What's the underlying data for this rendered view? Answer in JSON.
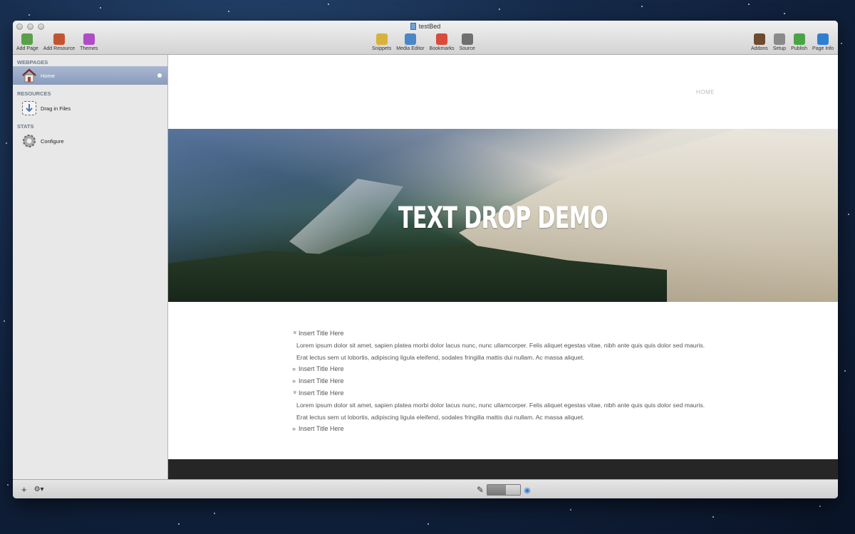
{
  "window": {
    "title": "testBed"
  },
  "toolbar": {
    "left": [
      {
        "label": "Add Page",
        "icon": "add-page-icon",
        "color": "#5aa04a"
      },
      {
        "label": "Add Resource",
        "icon": "add-resource-icon",
        "color": "#c2552f"
      },
      {
        "label": "Themes",
        "icon": "themes-icon",
        "color": "#b04cc8"
      }
    ],
    "center": [
      {
        "label": "Snippets",
        "icon": "snippets-icon",
        "color": "#d7b33b"
      },
      {
        "label": "Media Editor",
        "icon": "media-editor-icon",
        "color": "#4a86c8"
      },
      {
        "label": "Bookmarks",
        "icon": "bookmarks-icon",
        "color": "#d94b3a"
      },
      {
        "label": "Source",
        "icon": "source-icon",
        "color": "#6f6f6f"
      }
    ],
    "right": [
      {
        "label": "Addons",
        "icon": "addons-icon",
        "color": "#6e4a2e"
      },
      {
        "label": "Setup",
        "icon": "setup-icon",
        "color": "#8a8a8a"
      },
      {
        "label": "Publish",
        "icon": "publish-icon",
        "color": "#4aa446"
      },
      {
        "label": "Page Info",
        "icon": "page-info-icon",
        "color": "#2d7fd1"
      }
    ]
  },
  "sidebar": {
    "webpages_heading": "WEBPAGES",
    "home_label": "Home",
    "resources_heading": "RESOURCES",
    "drag_label": "Drag in Files",
    "stats_heading": "STATS",
    "configure_label": "Configure"
  },
  "page": {
    "nav_home": "HOME",
    "hero_title": "TEXT DROP DEMO",
    "accordion": [
      {
        "title": "Insert Title Here",
        "open": true,
        "body": "Lorem ipsum dolor sit amet, sapien platea morbi dolor lacus nunc, nunc ullamcorper. Felis aliquet egestas vitae, nibh ante quis quis dolor sed mauris. Erat lectus sem ut lobortis, adipiscing ligula eleifend, sodales fringilla mattis dui nullam. Ac massa aliquet."
      },
      {
        "title": "Insert Title Here",
        "open": false
      },
      {
        "title": "Insert Title Here",
        "open": false
      },
      {
        "title": "Insert Title Here",
        "open": true,
        "body": "Lorem ipsum dolor sit amet, sapien platea morbi dolor lacus nunc, nunc ullamcorper. Felis aliquet egestas vitae, nibh ante quis quis dolor sed mauris. Erat lectus sem ut lobortis, adipiscing ligula eleifend, sodales fringilla mattis dui nullam. Ac massa aliquet."
      },
      {
        "title": "Insert Title Here",
        "open": false
      }
    ],
    "chevron_open": "»",
    "chevron_closed": "»"
  },
  "bottombar": {
    "add": "+",
    "gear": "⚙▾",
    "edit_icon": "✎",
    "preview_icon": "◉"
  }
}
